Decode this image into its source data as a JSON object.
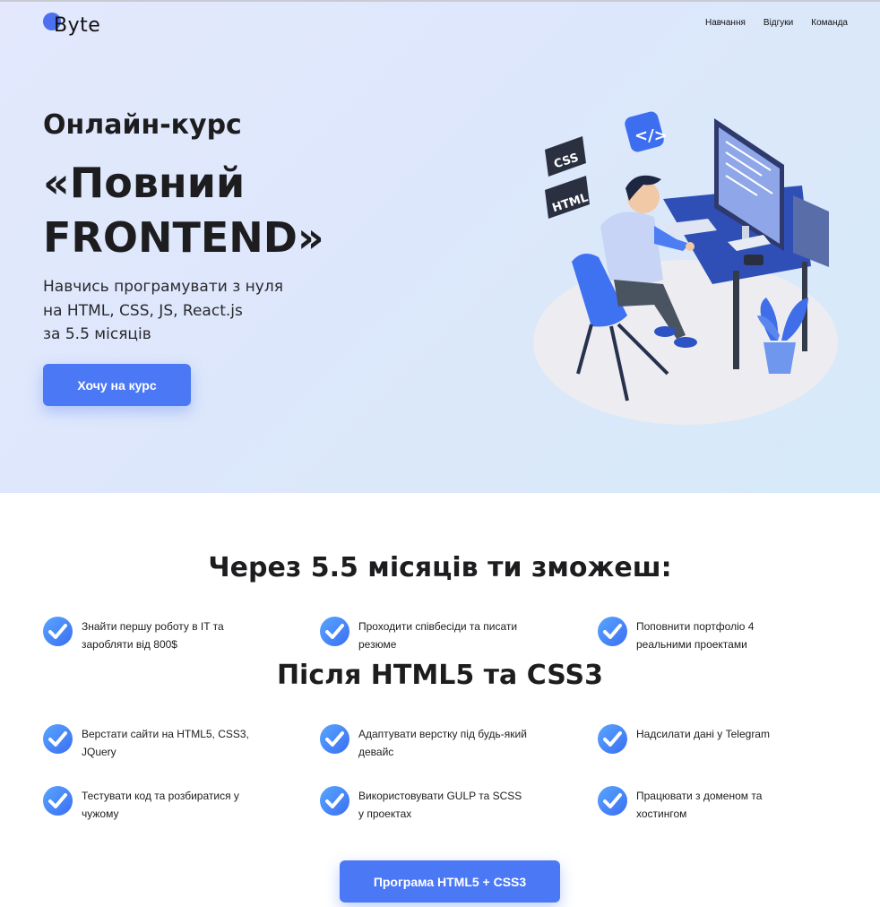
{
  "header": {
    "logo_text": "Byte",
    "nav": [
      "Навчання",
      "Відгуки",
      "Команда"
    ]
  },
  "hero": {
    "subtitle": "Онлайн-курс",
    "title": "«Повний FRONTEND»",
    "description_lines": [
      "Навчись програмувати з нуля",
      "на HTML, CSS, JS, React.js",
      "за 5.5 місяців"
    ],
    "cta": "Хочу на курс",
    "illustration_labels": [
      "CSS",
      "HTML",
      "</>"
    ]
  },
  "section1": {
    "title": "Через 5.5 місяців ти зможеш:",
    "features": [
      "Знайти першу роботу в IT та заробляти від 800$",
      "Проходити співбесіди та писати резюме",
      "Поповнити портфоліо 4 реальними проектами"
    ]
  },
  "section2": {
    "title": "Після HTML5 та CSS3",
    "features": [
      "Верстати сайти на HTML5, CSS3, JQuery",
      "Адаптувати верстку під будь-який девайс",
      "Надсилати дані у Telegram",
      "Тестувати код та розбиратися у чужому",
      "Використовувати GULP та SCSS у проектах",
      "Працювати з доменом та хостингом"
    ],
    "cta": "Програма HTML5 + CSS3"
  },
  "colors": {
    "accent": "#4b78f5",
    "hero_bg": "#dde7fb",
    "text": "#1d1d1f"
  },
  "icons": [
    "check-circle-icon"
  ]
}
